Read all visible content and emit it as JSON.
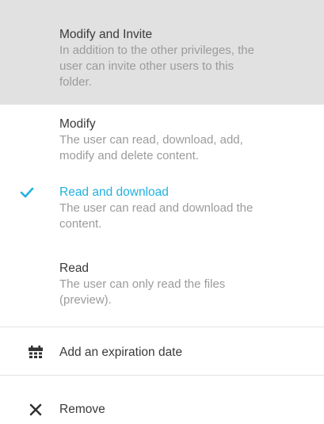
{
  "options": [
    {
      "title": "Modify and Invite",
      "description_lines": [
        "In addition to the other privileges, the",
        "user can invite other users to this",
        "folder."
      ]
    },
    {
      "title": "Modify",
      "description_lines": [
        "The user can read, download, add,",
        "modify and delete content."
      ]
    },
    {
      "title": "Read and download",
      "description_lines": [
        "The user can read and download the",
        "content."
      ]
    },
    {
      "title": "Read",
      "description_lines": [
        "The user can only read the files",
        "(preview)."
      ]
    }
  ],
  "actions": {
    "expiration_label": "Add an expiration date",
    "remove_label": "Remove"
  },
  "icons": {
    "selected_option": "checkmark-icon",
    "expiration": "calendar-icon",
    "remove": "close-icon"
  },
  "colors": {
    "selected_accent": "#23b1df",
    "highlight_background": "#e1e1e1",
    "primary_text": "#3a3a3a",
    "secondary_text": "#9b9b9b"
  }
}
